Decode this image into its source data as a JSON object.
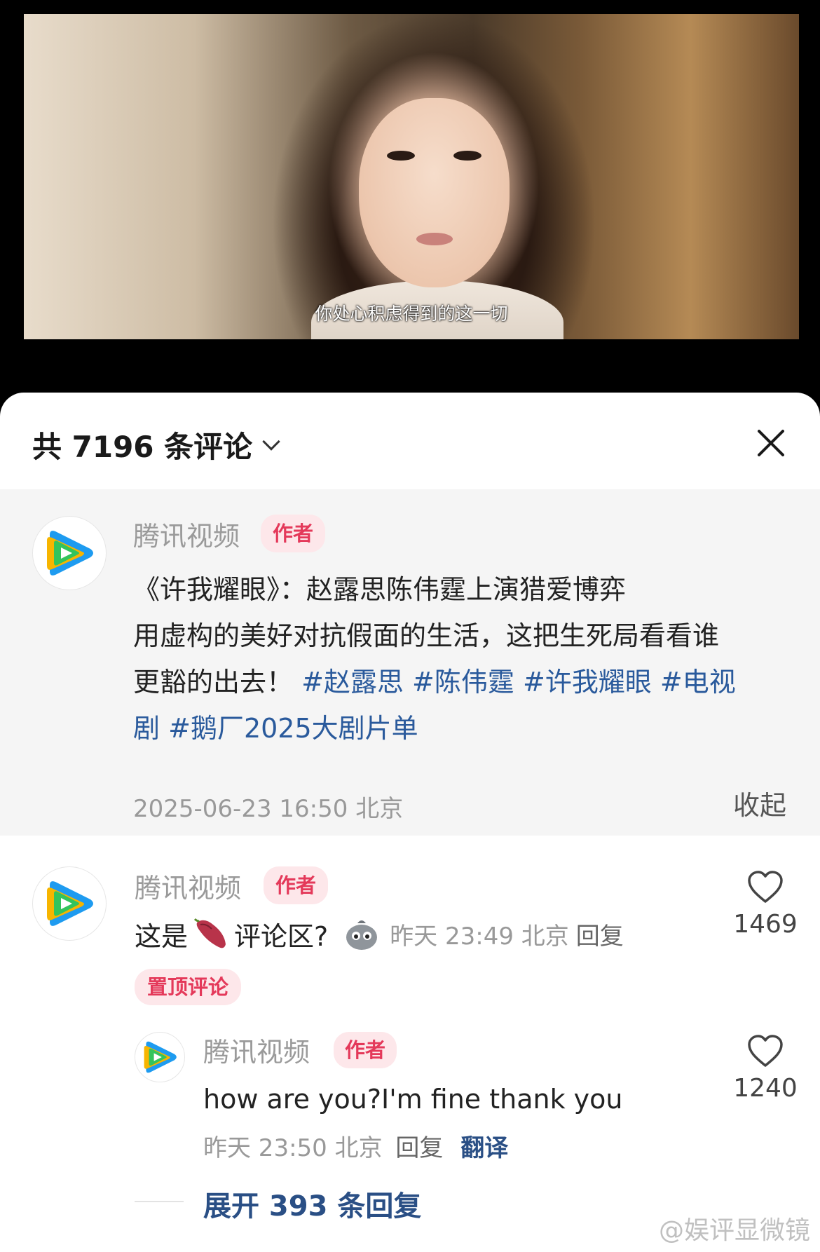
{
  "video": {
    "subtitle": "你处心积虑得到的这一切"
  },
  "sheet": {
    "comment_count_label": "共 7196 条评论"
  },
  "post": {
    "author": "腾讯视频",
    "badge": "作者",
    "lines": [
      {
        "text": "《许我耀眼》：赵露思陈伟霆上演猎爱博弈"
      },
      {
        "text": "用虚构的美好对抗假面的生活，这把生死局看看谁"
      },
      {
        "text": "更豁的出去！",
        "tags": [
          "#赵露思",
          "#陈伟霆",
          "#许我耀眼",
          "#电视"
        ]
      },
      {
        "tags": [
          "剧",
          "#鹅厂2025大剧片单"
        ]
      }
    ],
    "meta": "2025-06-23 16:50 北京",
    "collapse_label": "收起"
  },
  "comment": {
    "author": "腾讯视频",
    "badge": "作者",
    "text_before": "这是",
    "text_after": "评论区?",
    "meta": "昨天 23:49 北京",
    "reply_label": "回复",
    "likes": "1469",
    "pinned_label": "置顶评论"
  },
  "reply": {
    "author": "腾讯视频",
    "badge": "作者",
    "text": "how are you?I'm fine thank you",
    "meta": "昨天 23:50 北京",
    "reply_label": "回复",
    "translate_label": "翻译",
    "likes": "1240"
  },
  "expand_label": "展开 393 条回复",
  "watermark": "@娱评显微镜",
  "icons": {
    "avatar": "tencent-video-logo-icon",
    "like": "heart-icon",
    "close": "close-icon",
    "dropdown": "chevron-down-icon"
  },
  "colors": {
    "accent_link": "#2a4f85",
    "badge_text": "#e4395a",
    "badge_bg": "#fde7ea"
  }
}
